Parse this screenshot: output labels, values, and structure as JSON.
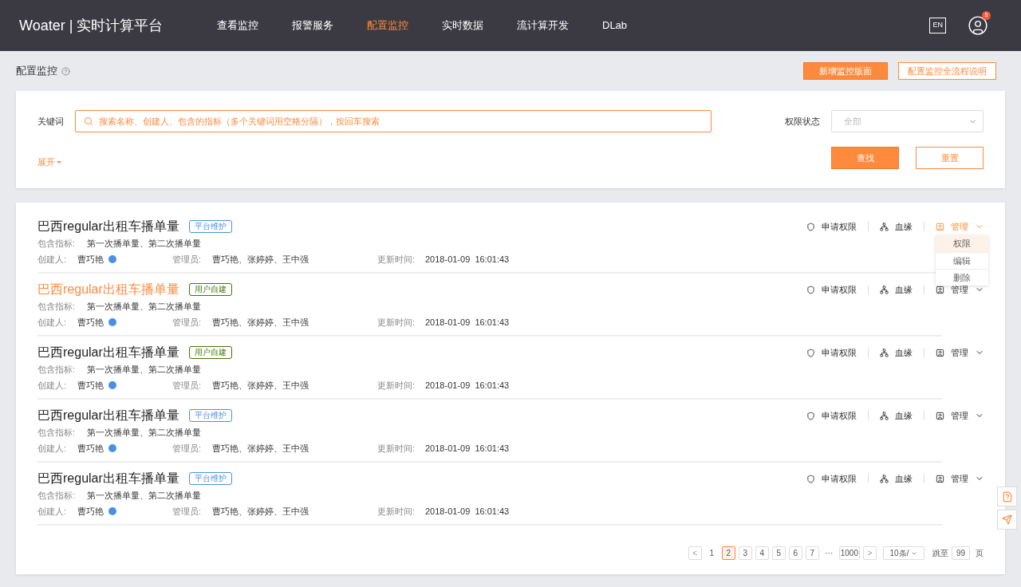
{
  "header": {
    "logo": "Woater | 实时计算平台",
    "nav": [
      {
        "label": "查看监控",
        "selected": false
      },
      {
        "label": "报警服务",
        "selected": false
      },
      {
        "label": "配置监控",
        "selected": true
      },
      {
        "label": "实时数据",
        "selected": false
      },
      {
        "label": "流计算开发",
        "selected": false
      },
      {
        "label": "DLab",
        "selected": false
      }
    ],
    "lang": "EN",
    "notifications": "5"
  },
  "page": {
    "title": "配置监控",
    "primary_button": "新增监控版面",
    "secondary_button": "配置监控全流程说明"
  },
  "filters": {
    "keyword_label": "关键词",
    "keyword_placeholder": "搜索名称、创建人、包含的指标（多个关键词用空格分隔），按回车搜索",
    "status_label": "权限状态",
    "status_value": "全部",
    "expand": "展开",
    "search_button": "查找",
    "reset_button": "重置"
  },
  "items": [
    {
      "title": "巴西regular出租车播单量",
      "selected": false,
      "tag": {
        "kind": "platform",
        "label": "平台维护"
      },
      "metrics_label": "包含指标:",
      "metrics": "第一次播单量、第二次播单量",
      "creator_label": "创建人:",
      "creator": "曹巧艳",
      "admins_label": "管理员:",
      "admins": "曹巧艳、张婷婷、王中强",
      "updated_label": "更新时间:",
      "updated": "2018-01-09  16:01:43",
      "actions": [
        "申请权限",
        "血缘",
        "管理"
      ],
      "menu_open": true
    },
    {
      "title": "巴西regular出租车播单量",
      "selected": true,
      "tag": {
        "kind": "user",
        "label": "用户自建"
      },
      "metrics_label": "包含指标:",
      "metrics": "第一次播单量、第二次播单量",
      "creator_label": "创建人:",
      "creator": "曹巧艳",
      "admins_label": "管理员:",
      "admins": "曹巧艳、张婷婷、王中强",
      "updated_label": "更新时间:",
      "updated": "2018-01-09  16:01:43",
      "actions": [
        "申请权限",
        "血缘",
        "管理"
      ],
      "menu_open": false
    },
    {
      "title": "巴西regular出租车播单量",
      "selected": false,
      "tag": {
        "kind": "user",
        "label": "用户自建"
      },
      "metrics_label": "包含指标:",
      "metrics": "第一次播单量、第二次播单量",
      "creator_label": "创建人:",
      "creator": "曹巧艳",
      "admins_label": "管理员:",
      "admins": "曹巧艳、张婷婷、王中强",
      "updated_label": "更新时间:",
      "updated": "2018-01-09  16:01:43",
      "actions": [
        "申请权限",
        "血缘",
        "管理"
      ],
      "menu_open": false
    },
    {
      "title": "巴西regular出租车播单量",
      "selected": false,
      "tag": {
        "kind": "platform",
        "label": "平台维护"
      },
      "metrics_label": "包含指标:",
      "metrics": "第一次播单量、第二次播单量",
      "creator_label": "创建人:",
      "creator": "曹巧艳",
      "admins_label": "管理员:",
      "admins": "曹巧艳、张婷婷、王中强",
      "updated_label": "更新时间:",
      "updated": "2018-01-09  16:01:43",
      "actions": [
        "申请权限",
        "血缘",
        "管理"
      ],
      "menu_open": false
    },
    {
      "title": "巴西regular出租车播单量",
      "selected": false,
      "tag": {
        "kind": "platform",
        "label": "平台维护"
      },
      "metrics_label": "包含指标:",
      "metrics": "第一次播单量、第二次播单量",
      "creator_label": "创建人:",
      "creator": "曹巧艳",
      "admins_label": "管理员:",
      "admins": "曹巧艳、张婷婷、王中强",
      "updated_label": "更新时间:",
      "updated": "2018-01-09  16:01:43",
      "actions": [
        "申请权限",
        "血缘",
        "管理"
      ],
      "menu_open": false
    }
  ],
  "manage_menu": [
    {
      "label": "权限",
      "selected": true
    },
    {
      "label": "编辑",
      "selected": false
    },
    {
      "label": "删除",
      "selected": false
    }
  ],
  "pagination": {
    "prev": "<",
    "pages": [
      {
        "label": "1",
        "selected": false
      },
      {
        "label": "2",
        "selected": true
      },
      {
        "label": "3",
        "selected": false
      },
      {
        "label": "4",
        "selected": false
      },
      {
        "label": "5",
        "selected": false
      },
      {
        "label": "6",
        "selected": false
      },
      {
        "label": "7",
        "selected": false
      },
      {
        "label": "···",
        "selected": false
      },
      {
        "label": "1000",
        "selected": false
      }
    ],
    "next": ">",
    "page_size": "10条/",
    "jump_label": "跳至",
    "jump_value": "99",
    "page_unit": "页"
  }
}
